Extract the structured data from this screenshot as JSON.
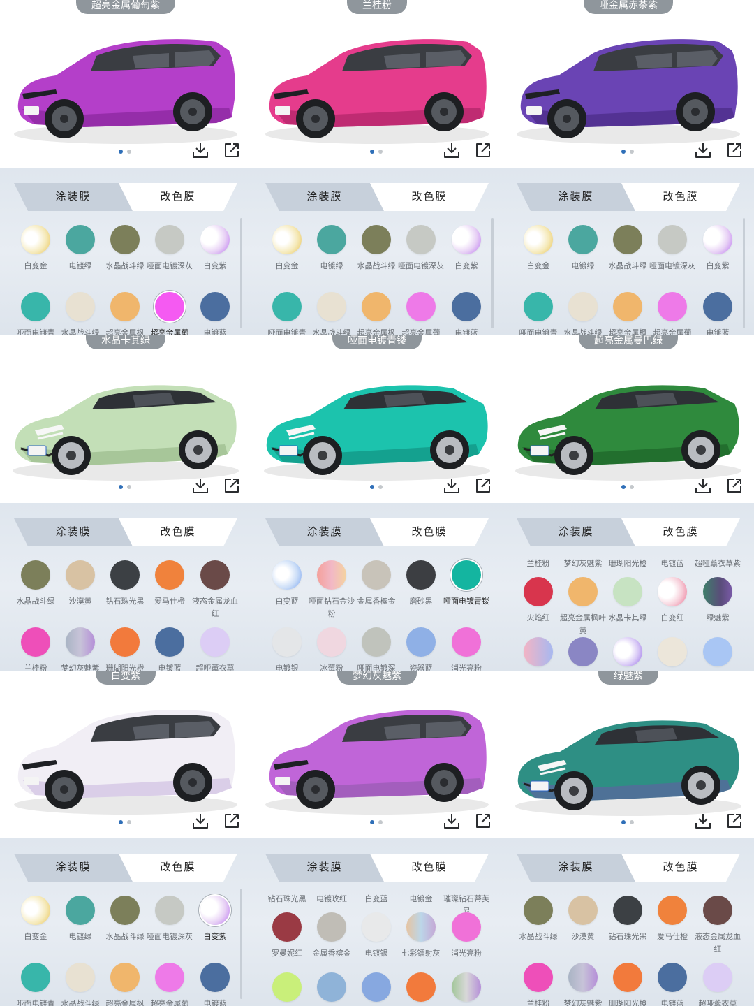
{
  "tabs": {
    "paint_label": "涂装膜",
    "wrap_label": "改色膜"
  },
  "cells": [
    {
      "name": "超亮金属葡萄紫",
      "car": "suv",
      "body_color": "#b43fc9",
      "body_shade": "#7b1f8e",
      "show_scrollbar": true,
      "swatches": [
        {
          "label": "白变金",
          "fill": "radial-gradient(circle at 35% 45%, #ffffff 25%, #f5e9b8 60%, #e8c04a 100%)"
        },
        {
          "label": "电镀绿",
          "fill": "#4ba79f"
        },
        {
          "label": "水晶战斗绿",
          "fill": "#7c7f5a"
        },
        {
          "label": "哑面电镀深灰",
          "fill": "#c6c9c4"
        },
        {
          "label": "白变紫",
          "fill": "radial-gradient(circle at 30% 40%, #ffffff 30%, #e7d0f5 60%, #b76cf0 100%)"
        },
        {
          "label": "哑面电镀青",
          "fill": "#38b6aa"
        },
        {
          "label": "水晶战斗绿",
          "fill": "#e8e1d2"
        },
        {
          "label": "超亮金属枫",
          "fill": "#f0b66c"
        },
        {
          "label": "超亮金属葡",
          "fill": "#f55af2",
          "selected": true
        },
        {
          "label": "电镀蓝",
          "fill": "#4b6e9f"
        }
      ]
    },
    {
      "name": "兰桂粉",
      "car": "suv",
      "body_color": "#e53c8c",
      "body_shade": "#a11e5c",
      "show_scrollbar": true,
      "swatches": [
        {
          "label": "白变金",
          "fill": "radial-gradient(circle at 35% 45%, #ffffff 25%, #f5e9b8 60%, #e8c04a 100%)"
        },
        {
          "label": "电镀绿",
          "fill": "#4ba79f"
        },
        {
          "label": "水晶战斗绿",
          "fill": "#7c7f5a"
        },
        {
          "label": "哑面电镀深灰",
          "fill": "#c6c9c4"
        },
        {
          "label": "白变紫",
          "fill": "radial-gradient(circle at 30% 40%, #ffffff 30%, #e7d0f5 60%, #b76cf0 100%)"
        },
        {
          "label": "哑面电镀青",
          "fill": "#38b6aa"
        },
        {
          "label": "水晶战斗绿",
          "fill": "#e8e1d2"
        },
        {
          "label": "超亮金属枫",
          "fill": "#f0b66c"
        },
        {
          "label": "超亮金属葡",
          "fill": "#ee7ae8"
        },
        {
          "label": "电镀蓝",
          "fill": "#4b6e9f"
        }
      ]
    },
    {
      "name": "哑金属赤茶紫",
      "car": "suv",
      "body_color": "#6a44b4",
      "body_shade": "#3f2578",
      "show_scrollbar": true,
      "swatches": [
        {
          "label": "白变金",
          "fill": "radial-gradient(circle at 35% 45%, #ffffff 25%, #f5e9b8 60%, #e8c04a 100%)"
        },
        {
          "label": "电镀绿",
          "fill": "#4ba79f"
        },
        {
          "label": "水晶战斗绿",
          "fill": "#7c7f5a"
        },
        {
          "label": "哑面电镀深灰",
          "fill": "#c6c9c4"
        },
        {
          "label": "白变紫",
          "fill": "radial-gradient(circle at 30% 40%, #ffffff 30%, #e7d0f5 60%, #b76cf0 100%)"
        },
        {
          "label": "哑面电镀青",
          "fill": "#38b6aa"
        },
        {
          "label": "水晶战斗绿",
          "fill": "#e8e1d2"
        },
        {
          "label": "超亮金属枫",
          "fill": "#f0b66c"
        },
        {
          "label": "超亮金属葡",
          "fill": "#ee7ae8"
        },
        {
          "label": "电镀蓝",
          "fill": "#4b6e9f"
        }
      ]
    },
    {
      "name": "水晶卡其绿",
      "car": "sedan",
      "body_color": "#c3dfb7",
      "body_shade": "#8fb182",
      "show_scrollbar": false,
      "swatches": [
        {
          "label": "水晶战斗绿",
          "fill": "#7c7f5a"
        },
        {
          "label": "沙漠黄",
          "fill": "#d8c2a3"
        },
        {
          "label": "钻石珠光黑",
          "fill": "#3c4044"
        },
        {
          "label": "爱马仕橙",
          "fill": "#f0823c"
        },
        {
          "label": "液态金属龙血红",
          "fill": "#6a4a48"
        },
        {
          "label": "兰桂粉",
          "fill": "#ee4fb9"
        },
        {
          "label": "梦幻灰魅紫",
          "fill": "linear-gradient(90deg, #a9b4c4 0%, #c7c3d8 50%, #b58fd8 100%)"
        },
        {
          "label": "珊瑚阳光橙",
          "fill": "#f27a3c"
        },
        {
          "label": "电镀蓝",
          "fill": "#4b6e9f"
        },
        {
          "label": "超哑薰衣草",
          "fill": "#dccdf5"
        }
      ]
    },
    {
      "name": "哑面电镀青镂",
      "car": "sedan",
      "body_color": "#1cc3ad",
      "body_shade": "#0e8576",
      "show_scrollbar": false,
      "swatches": [
        {
          "label": "白变蓝",
          "fill": "radial-gradient(circle at 35% 45%, #ffffff 25%, #c9dcf7 60%, #6f9df0 100%)"
        },
        {
          "label": "哑面钻石金沙粉",
          "fill": "linear-gradient(90deg, #f4a09a 0%, #f2b8c6 50%, #f4d3a0 100%)"
        },
        {
          "label": "金属香槟金",
          "fill": "#c8c3b9"
        },
        {
          "label": "磨砂黑",
          "fill": "#3c3e42"
        },
        {
          "label": "哑面电镀青镂",
          "fill": "#14b5a0",
          "selected": true
        },
        {
          "label": "电镀银",
          "fill": "#e4e6e8"
        },
        {
          "label": "冰莓粉",
          "fill": "#f0d7e0"
        },
        {
          "label": "哑面电镀深",
          "fill": "#c0c3bc"
        },
        {
          "label": "瓷器蓝",
          "fill": "#8fb0e6"
        },
        {
          "label": "消光亮粉",
          "fill": "#f071d8"
        }
      ]
    },
    {
      "name": "超亮金属曼巴绿",
      "car": "sedan",
      "body_color": "#2f8a3d",
      "body_shade": "#185a22",
      "show_scrollbar": false,
      "partial_top": true,
      "swatches": [
        {
          "label": "火焰红",
          "fill": "#d8354d"
        },
        {
          "label": "超亮金属枫叶黄",
          "fill": "#f0b66c"
        },
        {
          "label": "水晶卡其绿",
          "fill": "#c7e3c2"
        },
        {
          "label": "白变红",
          "fill": "radial-gradient(circle at 30% 45%, #ffffff 30%, #f6cdd8 60%, #ec6c8f 100%)"
        },
        {
          "label": "绿魅紫",
          "fill": "linear-gradient(90deg, #3e7f6a 0%, #5a4d7a 60%, #7a5aa8 100%)"
        },
        {
          "label": "",
          "fill": "linear-gradient(90deg, #f3b4c4 0%, #a7b8f0 100%)"
        },
        {
          "label": "",
          "fill": "#8a86c4"
        },
        {
          "label": "",
          "fill": "radial-gradient(circle at 35% 45%, #ffffff 30%, #d8c8f6 60%, #8e63e6 100%)"
        },
        {
          "label": "",
          "fill": "#ece6da"
        },
        {
          "label": "",
          "fill": "#a9c6f4"
        }
      ],
      "top_labels": [
        "兰桂粉",
        "梦幻灰魅紫",
        "珊瑚阳光橙",
        "电镀蓝",
        "超哑薰衣草紫"
      ]
    },
    {
      "name": "白变紫",
      "car": "suv",
      "body_color": "#f1eef5",
      "body_shade": "#c7b4dc",
      "show_scrollbar": true,
      "swatches": [
        {
          "label": "白变金",
          "fill": "radial-gradient(circle at 35% 45%, #ffffff 25%, #f5e9b8 60%, #e8c04a 100%)"
        },
        {
          "label": "电镀绿",
          "fill": "#4ba79f"
        },
        {
          "label": "水晶战斗绿",
          "fill": "#7c7f5a"
        },
        {
          "label": "哑面电镀深灰",
          "fill": "#c6c9c4"
        },
        {
          "label": "白变紫",
          "fill": "radial-gradient(circle at 30% 40%, #ffffff 30%, #e7d0f5 60%, #b76cf0 100%)",
          "selected": true
        },
        {
          "label": "哑面电镀青",
          "fill": "#38b6aa"
        },
        {
          "label": "水晶战斗绿",
          "fill": "#e8e1d2"
        },
        {
          "label": "超亮金属枫",
          "fill": "#f0b66c"
        },
        {
          "label": "超亮金属葡",
          "fill": "#ee7ae8"
        },
        {
          "label": "电镀蓝",
          "fill": "#4b6e9f"
        }
      ]
    },
    {
      "name": "梦幻灰魅紫",
      "car": "suv",
      "body_color": "#c065d8",
      "body_shade": "#8a5aa8",
      "show_scrollbar": false,
      "top_labels": [
        "钻石珠光黑",
        "电镀玫红",
        "白变蓝",
        "电镀金",
        "璀璨钻石蒂芙尼"
      ],
      "swatches": [
        {
          "label": "罗曼妮红",
          "fill": "#9a3a44"
        },
        {
          "label": "金属香槟金",
          "fill": "#c0bdb6"
        },
        {
          "label": "电镀银",
          "fill": "#e8e9ea"
        },
        {
          "label": "七彩镭射灰",
          "fill": "linear-gradient(90deg, #e6c4a2 0%, #bcd6e8 50%, #c5a8d6 100%)"
        },
        {
          "label": "消光亮粉",
          "fill": "#f071d8"
        },
        {
          "label": "",
          "fill": "#c9ef7a"
        },
        {
          "label": "",
          "fill": "#8fb3d8"
        },
        {
          "label": "",
          "fill": "#87a8e0"
        },
        {
          "label": "",
          "fill": "#f27a3c"
        },
        {
          "label": "",
          "fill": "linear-gradient(90deg, #a2c69a 0%, #d8d8d8 50%, #b58fd8 100%)"
        }
      ]
    },
    {
      "name": "绿魅紫",
      "car": "sedan",
      "body_color": "#2e8f84",
      "body_shade": "#6a5aa8",
      "show_scrollbar": false,
      "swatches": [
        {
          "label": "水晶战斗绿",
          "fill": "#7c7f5a"
        },
        {
          "label": "沙漠黄",
          "fill": "#d8c2a3"
        },
        {
          "label": "钻石珠光黑",
          "fill": "#3c4044"
        },
        {
          "label": "爱马仕橙",
          "fill": "#f0823c"
        },
        {
          "label": "液态金属龙血红",
          "fill": "#6a4a48"
        },
        {
          "label": "兰桂粉",
          "fill": "#ee4fb9"
        },
        {
          "label": "梦幻灰魅紫",
          "fill": "linear-gradient(90deg, #a9b4c4 0%, #c7c3d8 50%, #b58fd8 100%)"
        },
        {
          "label": "珊瑚阳光橙",
          "fill": "#f27a3c"
        },
        {
          "label": "电镀蓝",
          "fill": "#4b6e9f"
        },
        {
          "label": "超哑薰衣草",
          "fill": "#dccdf5"
        }
      ]
    }
  ]
}
